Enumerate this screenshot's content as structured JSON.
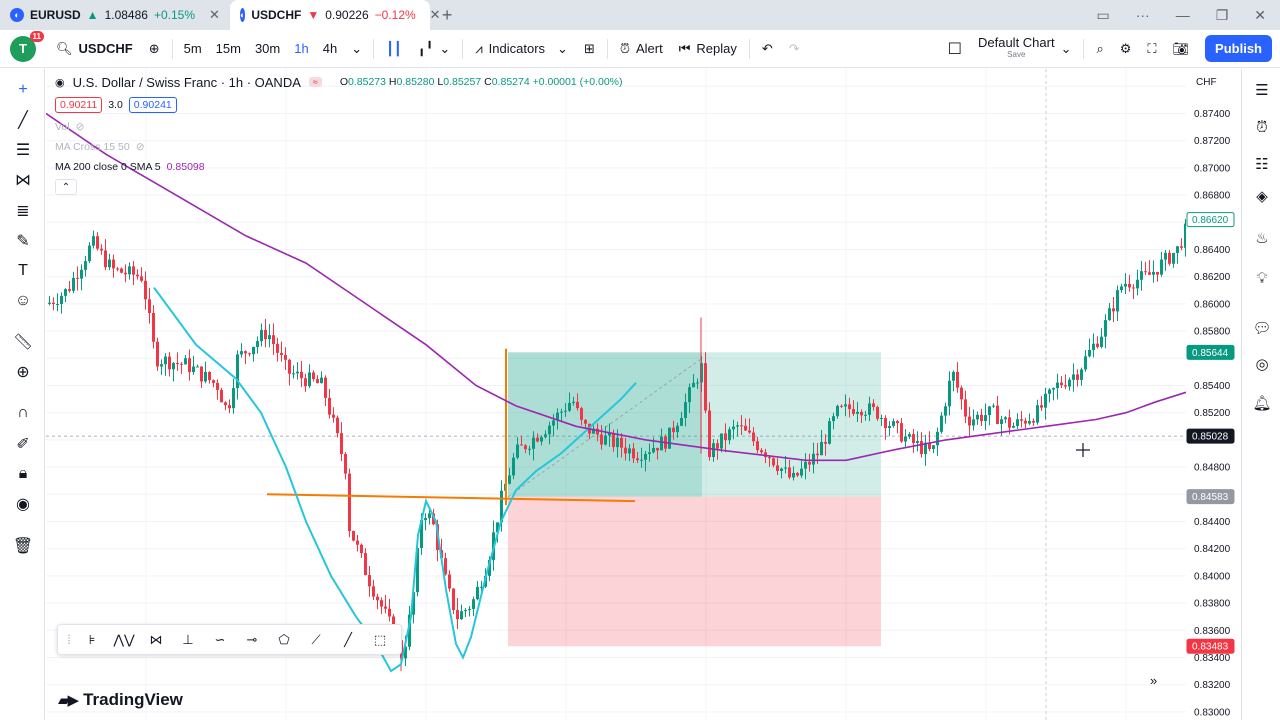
{
  "browser": {
    "tabs": [
      {
        "symbol": "EURUSD",
        "direction": "▲",
        "price": "1.08486",
        "change": "+0.15%",
        "trend": "up"
      },
      {
        "symbol": "USDCHF",
        "direction": "▼",
        "price": "0.90226",
        "change": "−0.12%",
        "trend": "down"
      }
    ]
  },
  "toolbar": {
    "avatar_letter": "T",
    "notifications": "11",
    "symbol": "USDCHF",
    "timeframes": [
      "5m",
      "15m",
      "30m",
      "1h",
      "4h"
    ],
    "active_timeframe": "1h",
    "indicators_label": "Indicators",
    "alert_label": "Alert",
    "replay_label": "Replay",
    "layout_label": "Default Chart",
    "layout_sub": "Save",
    "publish_label": "Publish"
  },
  "legend": {
    "title": "U.S. Dollar / Swiss Franc · 1h · OANDA",
    "open_label": "O",
    "open": "0.85273",
    "high_label": "H",
    "high": "0.85280",
    "low_label": "L",
    "low": "0.85257",
    "close_label": "C",
    "close": "0.85274",
    "change": "+0.00001 (+0.00%)",
    "sell_price": "0.90211",
    "spread": "3.0",
    "buy_price": "0.90241",
    "vol_label": "Vol",
    "ma_cross_label": "MA Cross 15 50",
    "ma200_label": "MA 200 close 0 SMA 5",
    "ma200_value": "0.85098"
  },
  "price_axis": {
    "currency": "CHF",
    "ticks": [
      "0.87400",
      "0.87200",
      "0.87000",
      "0.86800",
      "0.86400",
      "0.86200",
      "0.86000",
      "0.85800",
      "0.85400",
      "0.85200",
      "0.84800",
      "0.84400",
      "0.84200",
      "0.84000",
      "0.83800",
      "0.83600",
      "0.83400",
      "0.83200",
      "0.83000"
    ],
    "labels": {
      "high": "0.86620",
      "target": "0.85644",
      "current": "0.85028",
      "entry": "0.84583",
      "stop": "0.83483"
    }
  },
  "colors": {
    "up": "#089981",
    "down": "#f23645",
    "ma200": "#9c27b0",
    "curve": "#26c6da",
    "level": "#f57c00",
    "accent": "#2962ff"
  },
  "brand": "TradingView"
}
